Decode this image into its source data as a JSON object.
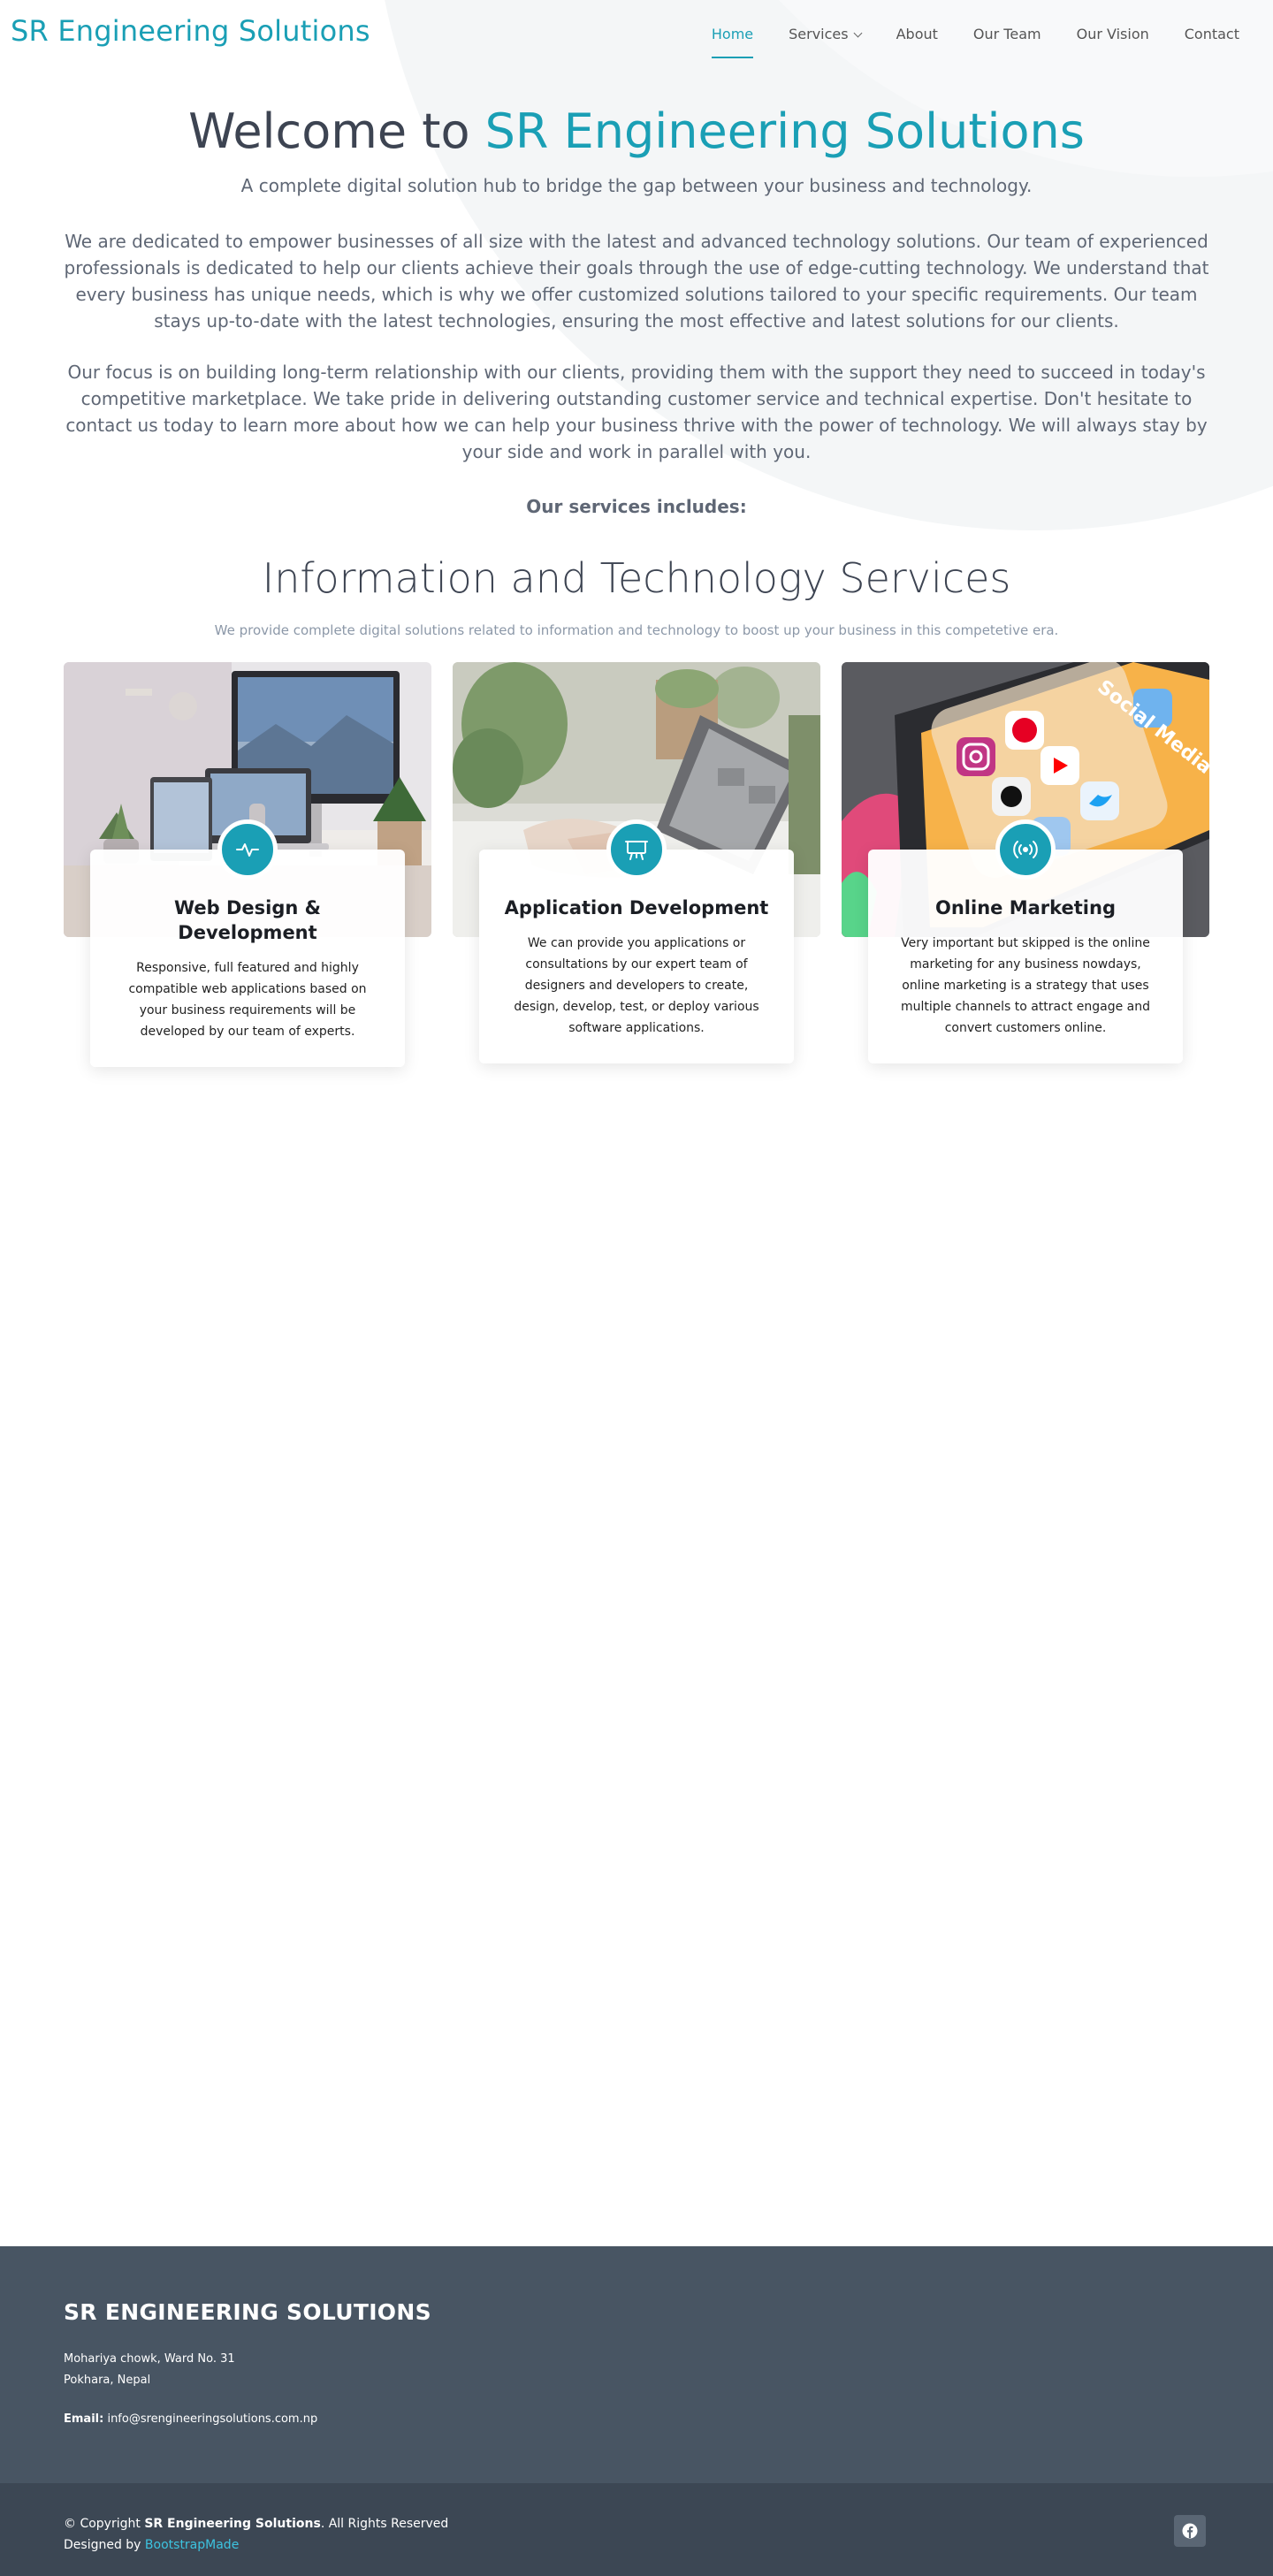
{
  "header": {
    "logo": "SR Engineering Solutions",
    "nav": [
      {
        "label": "Home",
        "active": true
      },
      {
        "label": "Services",
        "dropdown": true
      },
      {
        "label": "About"
      },
      {
        "label": "Our Team"
      },
      {
        "label": "Our Vision"
      },
      {
        "label": "Contact"
      }
    ]
  },
  "welcome": {
    "title_prefix": "Welcome to",
    "title_accent": "SR Engineering Solutions",
    "tagline": "A complete digital solution hub to bridge the gap between your business and technology.",
    "paragraph1": "We are dedicated to empower businesses of all size with the latest and advanced technology solutions. Our team of experienced professionals is dedicated to help our clients achieve their goals through the use of edge-cutting technology. We understand that every business has unique needs, which is why we offer customized solutions tailored to your specific requirements. Our team stays up-to-date with the latest technologies, ensuring the most effective and latest solutions for our clients.",
    "paragraph2": "Our focus is on building long-term relationship with our clients, providing them with the support they need to succeed in today's competitive marketplace. We take pride in delivering outstanding customer service and technical expertise. Don't hesitate to contact us today to learn more about how we can help your business thrive with the power of technology. We will always stay by your side and work in parallel with you.",
    "services_includes": "Our services includes:",
    "section_title": "Information and Technology Services",
    "section_subtitle": "We provide complete digital solutions related to information and technology to boost up your business in this competetive era."
  },
  "cards": [
    {
      "title": "Web Design & Development",
      "description": "Responsive, full featured and highly compatible web applications based on your business requirements will be developed by our team of experts.",
      "icon": "activity-icon"
    },
    {
      "title": "Application Development",
      "description": "We can provide you applications or consultations by our expert team of designers and developers to create, design, develop, test, or deploy various software applications.",
      "icon": "easel-icon"
    },
    {
      "title": "Online Marketing",
      "description": "Very important but skipped is the online marketing for any business nowdays, online marketing is a strategy that uses multiple channels to attract engage and convert customers online.",
      "icon": "broadcast-icon"
    }
  ],
  "footer": {
    "company": "SR ENGINEERING SOLUTIONS",
    "address_line1": "Mohariya chowk, Ward No. 31",
    "address_line2": "Pokhara, Nepal",
    "email_label": "Email:",
    "email": "info@srengineeringsolutions.com.np",
    "copyright_prefix": "© Copyright",
    "copyright_name": "SR Engineering Solutions",
    "copyright_suffix": ". All Rights Reserved",
    "designed_by": "Designed by",
    "designer": "BootstrapMade"
  },
  "colors": {
    "accent": "#1a9fb5",
    "footer_top": "#485563",
    "footer_bottom": "#3c4754"
  }
}
